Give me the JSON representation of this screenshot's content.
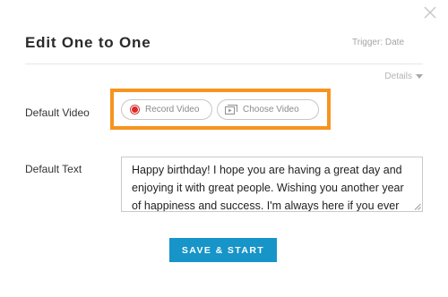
{
  "modal": {
    "title": "Edit One to One",
    "trigger_label": "Trigger: Date",
    "details_label": "Details",
    "close_icon": "close-icon"
  },
  "video": {
    "label": "Default Video",
    "record_label": "Record Video",
    "choose_label": "Choose Video",
    "record_icon": "record-icon",
    "choose_icon": "film-icon",
    "highlight_color": "#f7941e"
  },
  "text": {
    "label": "Default Text",
    "value": "Happy birthday! I hope you are having a great day and enjoying it with great people. Wishing you another year of happiness and success. I'm always here if you ever need anything. \"first name\""
  },
  "actions": {
    "save_label": "SAVE & START",
    "save_color": "#1794c8"
  }
}
